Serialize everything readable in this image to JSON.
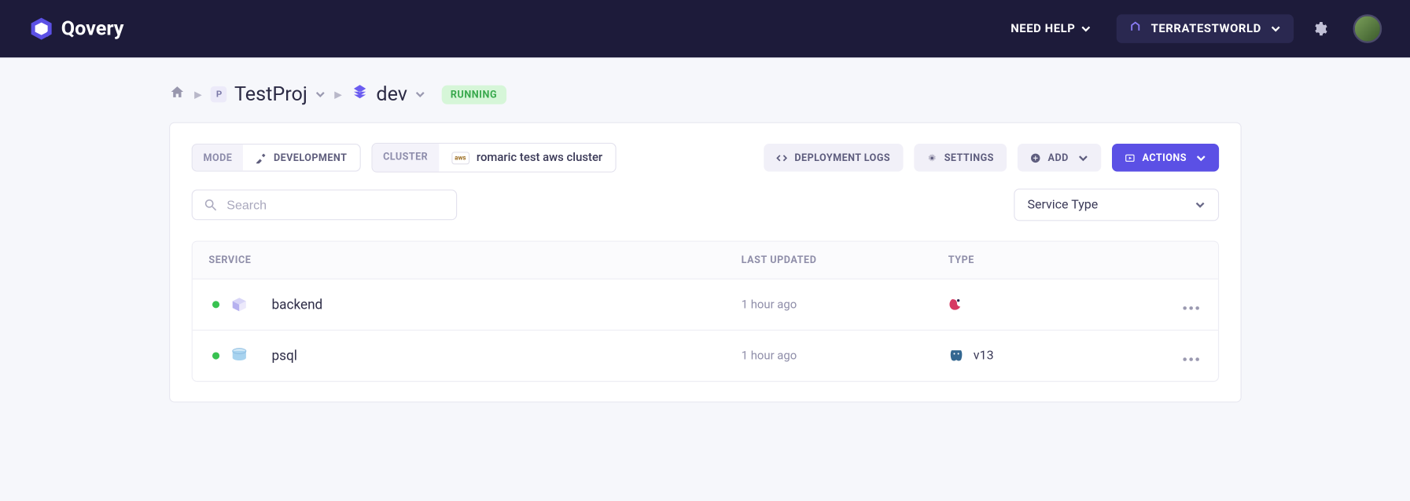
{
  "topbar": {
    "brand": "Qovery",
    "help_label": "NEED HELP",
    "org_name": "TERRATESTWORLD"
  },
  "breadcrumb": {
    "project_name": "TestProj",
    "project_badge": "P",
    "environment_name": "dev",
    "status": "RUNNING"
  },
  "meta": {
    "mode_label": "MODE",
    "mode_value": "DEVELOPMENT",
    "cluster_label": "CLUSTER",
    "cluster_provider": "aws",
    "cluster_name": "romaric test aws cluster"
  },
  "buttons": {
    "deployment_logs": "DEPLOYMENT LOGS",
    "settings": "SETTINGS",
    "add": "ADD",
    "actions": "ACTIONS"
  },
  "search": {
    "placeholder": "Search"
  },
  "filter": {
    "service_type_label": "Service Type"
  },
  "table": {
    "headers": {
      "service": "SERVICE",
      "last_updated": "LAST UPDATED",
      "type": "TYPE"
    },
    "rows": [
      {
        "status": "running",
        "name": "backend",
        "last_updated": "1 hour ago",
        "type_label": "",
        "type_kind": "app"
      },
      {
        "status": "running",
        "name": "psql",
        "last_updated": "1 hour ago",
        "type_label": "v13",
        "type_kind": "postgres"
      }
    ]
  }
}
